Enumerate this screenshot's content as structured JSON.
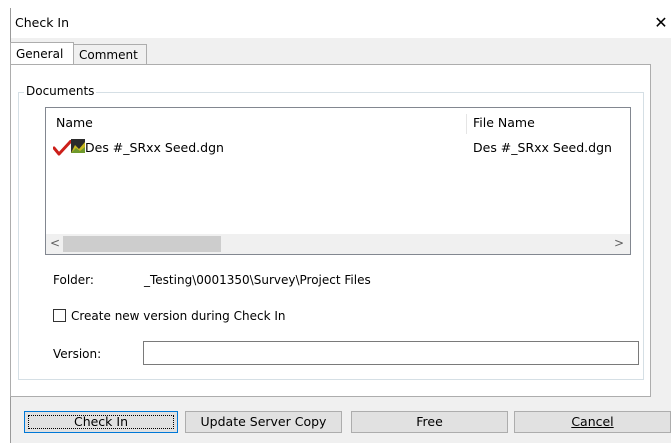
{
  "window": {
    "title": "Check In",
    "close_glyph": "✕"
  },
  "tabs": [
    {
      "label": "General",
      "active": true
    },
    {
      "label": "Comment",
      "active": false
    }
  ],
  "documents": {
    "group_label": "Documents",
    "columns": [
      "Name",
      "File Name"
    ],
    "rows": [
      {
        "name": "Des #_SRxx Seed.dgn",
        "file_name": "Des #_SRxx Seed.dgn",
        "icons": [
          "checkmark-icon",
          "dgn-document-icon"
        ]
      }
    ]
  },
  "folder": {
    "label": "Folder:",
    "value": "_Testing\\0001350\\Survey\\Project Files"
  },
  "create_version": {
    "label": "Create new version during Check In",
    "checked": false
  },
  "version": {
    "label": "Version:",
    "value": ""
  },
  "buttons": {
    "check_in": "Check In",
    "update_server_copy": "Update Server Copy",
    "free": "Free",
    "cancel": "Cancel"
  },
  "colors": {
    "checkmark": "#cc1f1a",
    "focus_border": "#0078d7"
  }
}
